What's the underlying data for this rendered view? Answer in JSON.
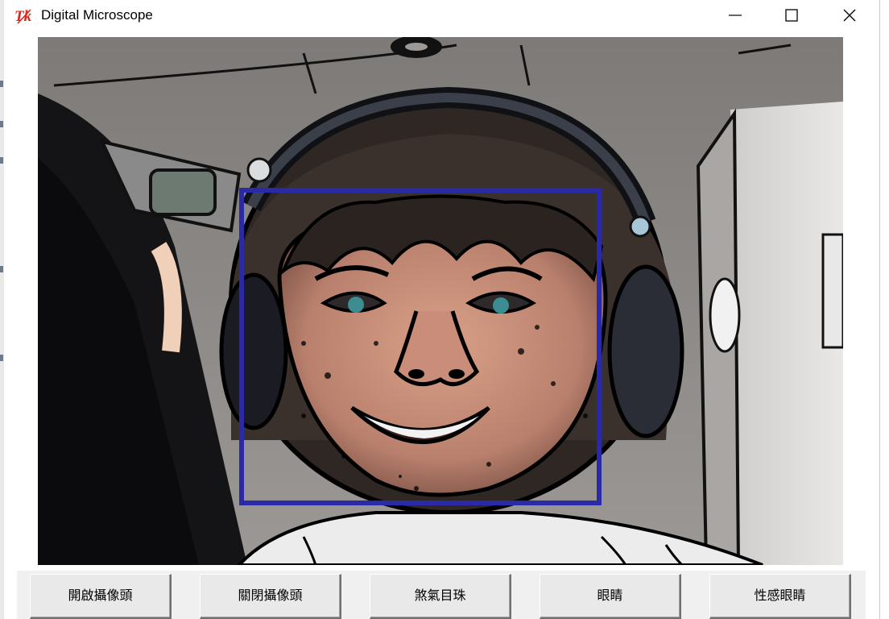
{
  "window": {
    "title": "Digital Microscope",
    "controls": {
      "minimize": "minimize-icon",
      "maximize": "maximize-icon",
      "close": "close-icon"
    }
  },
  "camera_view": {
    "face_box_color": "#2a2aa8",
    "description_icon": "camera-feed"
  },
  "buttons": [
    {
      "label": "開啟攝像頭"
    },
    {
      "label": "關閉攝像頭"
    },
    {
      "label": "煞氣目珠"
    },
    {
      "label": "眼睛"
    },
    {
      "label": "性感眼睛"
    }
  ],
  "colors": {
    "face_box": "#2a2aa8",
    "tk_logo_red": "#e0261b"
  }
}
